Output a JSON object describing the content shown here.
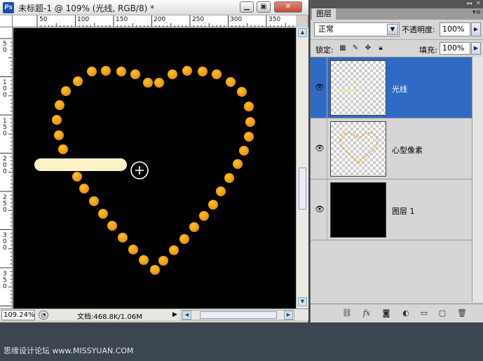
{
  "document": {
    "app_icon": "Ps",
    "title": "未标题-1 @ 109% (光线, RGB/8) *",
    "window_buttons": {
      "minimize": "▁",
      "maximize": "▣",
      "close": "✕"
    },
    "ruler_top_labels": [
      "50",
      "100",
      "150",
      "200",
      "250",
      "300",
      "350"
    ],
    "ruler_left_labels": [
      "5 0",
      "1 0 0",
      "1 5 0",
      "2 0 0",
      "2 5 0",
      "3 0 0",
      "3 5 0"
    ],
    "status": {
      "zoom": "109.24%",
      "doc_info": "文档:468.8K/1.06M",
      "arrow": "▶"
    }
  },
  "canvas": {
    "background": "#000000",
    "dot_color": "#f5a000",
    "bar_color": "#fbf2c6",
    "cursor": "crosshair-circle-icon"
  },
  "layers_panel": {
    "tab": "图层",
    "menu_icon": "▾≡",
    "blend_mode": "正常",
    "opacity_label": "不透明度:",
    "opacity_value": "100%",
    "lock_label": "锁定:",
    "fill_label": "填充:",
    "fill_value": "100%",
    "layers": [
      {
        "name": "光线",
        "selected": true,
        "visible": true
      },
      {
        "name": "心型像素",
        "selected": false,
        "visible": true
      },
      {
        "name": "图层 1",
        "selected": false,
        "visible": true
      }
    ],
    "selected_color": "#2f6ac5"
  },
  "watermark": "思缘设计论坛 www.MISSYUAN.COM"
}
